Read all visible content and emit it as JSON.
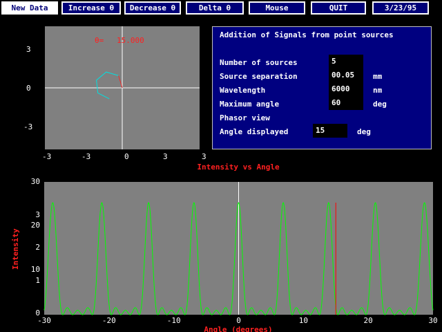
{
  "toolbar": {
    "new_data": "New Data",
    "increase": "Increase θ",
    "decrease": "Decrease θ",
    "delta": "Delta θ",
    "mouse": "Mouse",
    "quit": "QUIT",
    "date": "3/23/95"
  },
  "phasor": {
    "theta_label": "θ=",
    "theta_value": "15.000",
    "y_ticks": [
      "3",
      "0",
      "-3"
    ],
    "x_ticks": [
      "-3",
      "-3",
      "0",
      "3",
      "3"
    ]
  },
  "info": {
    "title": "Addition of Signals from point sources",
    "rows": [
      {
        "label": "Number of sources",
        "value": "5",
        "unit": ""
      },
      {
        "label": "Source separation",
        "value": "00.05",
        "unit": "mm"
      },
      {
        "label": "Wavelength",
        "value": "6000",
        "unit": "nm"
      },
      {
        "label": "Maximum angle",
        "value": "60",
        "unit": "deg"
      },
      {
        "label": "Phasor view",
        "value": "",
        "unit": ""
      },
      {
        "label": "Angle displayed",
        "value": "15",
        "unit": "deg"
      }
    ]
  },
  "colors": {
    "plot_bg": "#808080",
    "curve": "#00ff00",
    "marker": "#ff0000",
    "phasor": "#00e0e0",
    "panel_bg": "#000080"
  },
  "chart_data": {
    "type": "line",
    "title": "Intensity vs Angle",
    "xlabel": "Angle (degrees)",
    "ylabel": "Intensity",
    "xlim": [
      -30,
      30
    ],
    "x_ticks": [
      "-30",
      "-20",
      "-10",
      "0",
      "10",
      "20",
      "30"
    ],
    "y_ticks_left": [
      "30",
      "3",
      "20",
      "2",
      "10",
      "1",
      "0"
    ],
    "series": [
      {
        "sources": 5,
        "separation_mm": 0.05,
        "wavelength_nm": 6000
      }
    ],
    "peak_angles": [
      -28.7,
      -21.1,
      -13.9,
      -6.9,
      0,
      6.9,
      13.9,
      21.1,
      28.7
    ],
    "marker_angle": 15
  }
}
